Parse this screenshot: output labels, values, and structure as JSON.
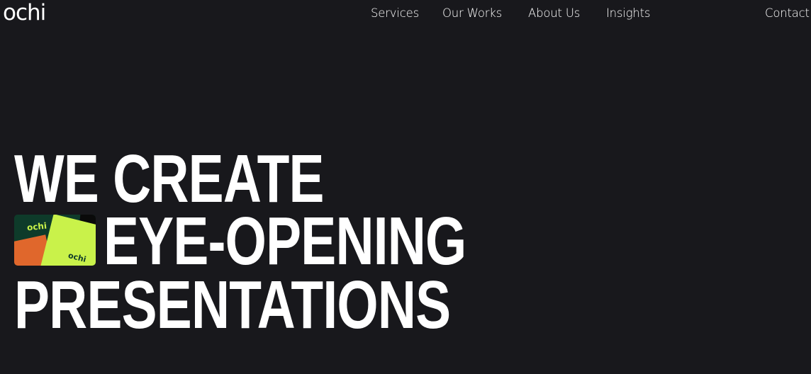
{
  "header": {
    "logo": "ochi",
    "nav": [
      {
        "label": "Services"
      },
      {
        "label": "Our Works"
      },
      {
        "label": "About Us"
      },
      {
        "label": "Insights"
      },
      {
        "label": "Contact"
      }
    ]
  },
  "hero": {
    "line1": "WE CREATE",
    "line2": "EYE-OPENING",
    "line3": "PRESENTATIONS",
    "thumbnail": {
      "logo_text_1": "ochi",
      "logo_text_2": "ochi"
    }
  },
  "colors": {
    "background": "#18181c",
    "text": "#ffffff",
    "accent_lime": "#c9f24a",
    "accent_green": "#0e3b2a",
    "accent_orange": "#e0672c"
  }
}
